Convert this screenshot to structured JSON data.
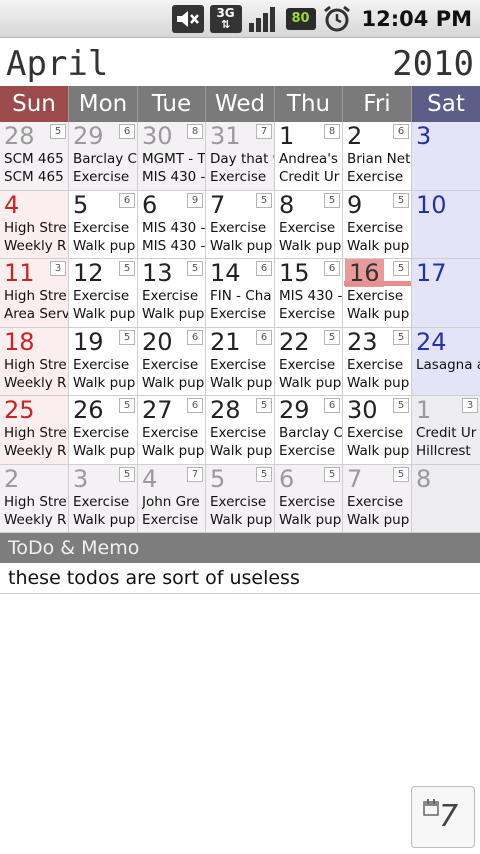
{
  "status_bar": {
    "network_label": "3G",
    "battery_level": "80",
    "time": "12:04 PM",
    "icons": [
      "mute-icon",
      "network-3g-icon",
      "signal-icon",
      "battery-icon",
      "alarm-icon"
    ]
  },
  "header": {
    "month": "April",
    "year": "2010"
  },
  "weekdays": [
    "Sun",
    "Mon",
    "Tue",
    "Wed",
    "Thu",
    "Fri",
    "Sat"
  ],
  "weeks": [
    [
      {
        "day": "28",
        "count": "5",
        "ev": [
          "SCM 465",
          "SCM 465"
        ],
        "other": true
      },
      {
        "day": "29",
        "count": "6",
        "ev": [
          "Barclay C",
          "Exercise"
        ],
        "other": true
      },
      {
        "day": "30",
        "count": "8",
        "ev": [
          "MGMT - T",
          "MIS 430 -"
        ],
        "other": true
      },
      {
        "day": "31",
        "count": "7",
        "ev": [
          "Day that w",
          "Exercise"
        ],
        "other": true
      },
      {
        "day": "1",
        "count": "8",
        "ev": [
          "Andrea's",
          "Credit Ur"
        ]
      },
      {
        "day": "2",
        "count": "6",
        "ev": [
          "Brian Net",
          "Exercise"
        ]
      },
      {
        "day": "3",
        "count": "",
        "ev": [
          "",
          ""
        ]
      }
    ],
    [
      {
        "day": "4",
        "count": "",
        "ev": [
          "High Stre",
          "Weekly R"
        ]
      },
      {
        "day": "5",
        "count": "6",
        "ev": [
          "Exercise",
          "Walk pup"
        ]
      },
      {
        "day": "6",
        "count": "9",
        "ev": [
          "MIS 430 -",
          "MIS 430 -"
        ]
      },
      {
        "day": "7",
        "count": "5",
        "ev": [
          "Exercise",
          "Walk pup"
        ]
      },
      {
        "day": "8",
        "count": "5",
        "ev": [
          "Exercise",
          "Walk pup"
        ]
      },
      {
        "day": "9",
        "count": "5",
        "ev": [
          "Exercise",
          "Walk pup"
        ]
      },
      {
        "day": "10",
        "count": "",
        "ev": [
          "",
          ""
        ]
      }
    ],
    [
      {
        "day": "11",
        "count": "3",
        "ev": [
          "High Stre",
          "Area Serv"
        ]
      },
      {
        "day": "12",
        "count": "5",
        "ev": [
          "Exercise",
          "Walk pup"
        ]
      },
      {
        "day": "13",
        "count": "5",
        "ev": [
          "Exercise",
          "Walk pup"
        ]
      },
      {
        "day": "14",
        "count": "6",
        "ev": [
          "FIN - Cha",
          "Exercise"
        ]
      },
      {
        "day": "15",
        "count": "6",
        "ev": [
          "MIS 430 -",
          "Exercise"
        ]
      },
      {
        "day": "16",
        "count": "5",
        "ev": [
          "Exercise",
          "Walk pup"
        ],
        "today": true
      },
      {
        "day": "17",
        "count": "",
        "ev": [
          "",
          ""
        ]
      }
    ],
    [
      {
        "day": "18",
        "count": "",
        "ev": [
          "High Stre",
          "Weekly R"
        ]
      },
      {
        "day": "19",
        "count": "5",
        "ev": [
          "Exercise",
          "Walk pup"
        ]
      },
      {
        "day": "20",
        "count": "6",
        "ev": [
          "Exercise",
          "Walk pup"
        ]
      },
      {
        "day": "21",
        "count": "6",
        "ev": [
          "Exercise",
          "Walk pup"
        ]
      },
      {
        "day": "22",
        "count": "5",
        "ev": [
          "Exercise",
          "Walk pup"
        ]
      },
      {
        "day": "23",
        "count": "5",
        "ev": [
          "Exercise",
          "Walk pup"
        ]
      },
      {
        "day": "24",
        "count": "",
        "ev": [
          "Lasagna a",
          ""
        ]
      }
    ],
    [
      {
        "day": "25",
        "count": "",
        "ev": [
          "High Stre",
          "Weekly R"
        ]
      },
      {
        "day": "26",
        "count": "5",
        "ev": [
          "Exercise",
          "Walk pup"
        ]
      },
      {
        "day": "27",
        "count": "6",
        "ev": [
          "Exercise",
          "Walk pup"
        ]
      },
      {
        "day": "28",
        "count": "5",
        "ev": [
          "Exercise",
          "Walk pup"
        ]
      },
      {
        "day": "29",
        "count": "6",
        "ev": [
          "Barclay C",
          "Exercise"
        ]
      },
      {
        "day": "30",
        "count": "5",
        "ev": [
          "Exercise",
          "Walk pup"
        ]
      },
      {
        "day": "1",
        "count": "3",
        "ev": [
          "Credit Ur",
          "Hillcrest"
        ],
        "other": true
      }
    ],
    [
      {
        "day": "2",
        "count": "",
        "ev": [
          "High Stre",
          "Weekly R"
        ],
        "other": true
      },
      {
        "day": "3",
        "count": "5",
        "ev": [
          "Exercise",
          "Walk pup"
        ],
        "other": true
      },
      {
        "day": "4",
        "count": "7",
        "ev": [
          "John Gre",
          "Exercise"
        ],
        "other": true
      },
      {
        "day": "5",
        "count": "5",
        "ev": [
          "Exercise",
          "Walk pup"
        ],
        "other": true
      },
      {
        "day": "6",
        "count": "5",
        "ev": [
          "Exercise",
          "Walk pup"
        ],
        "other": true
      },
      {
        "day": "7",
        "count": "5",
        "ev": [
          "Exercise",
          "Walk pup"
        ],
        "other": true
      },
      {
        "day": "8",
        "count": "",
        "ev": [
          "",
          ""
        ],
        "other": true
      }
    ]
  ],
  "todo": {
    "title": "ToDo & Memo",
    "items": [
      "these todos are sort of useless"
    ]
  },
  "today_button": {
    "label": "7"
  }
}
